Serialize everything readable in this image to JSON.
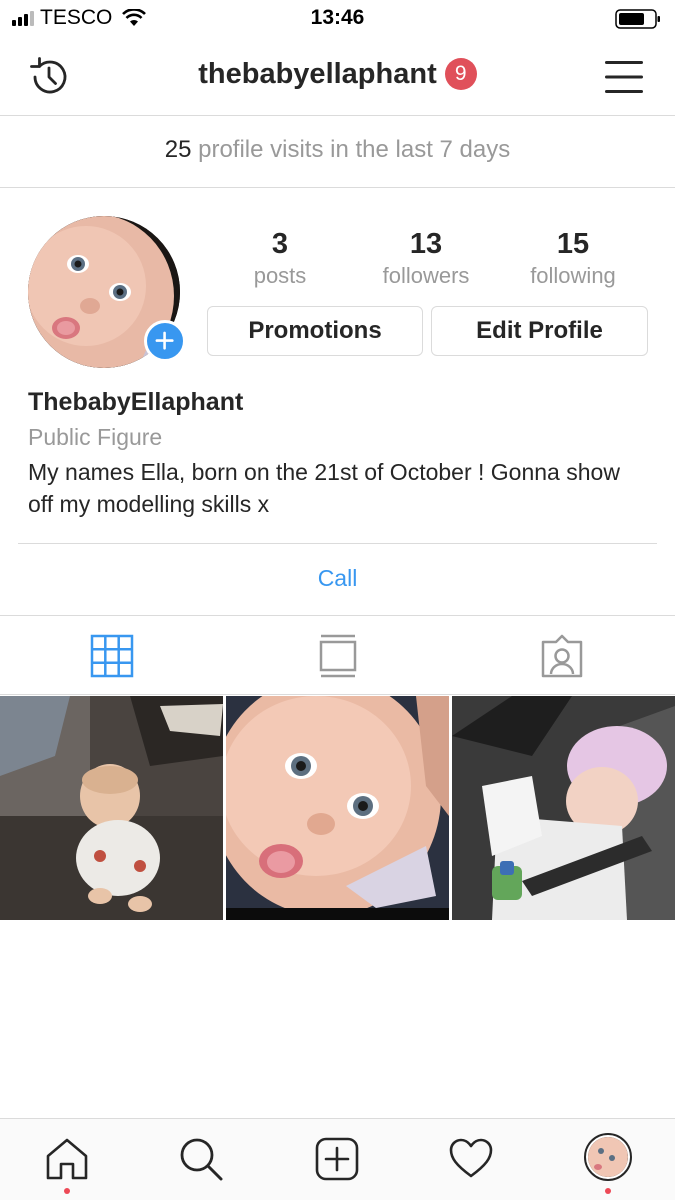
{
  "status_bar": {
    "carrier": "TESCO",
    "time": "13:46",
    "signal_bars": 3
  },
  "header": {
    "username": "thebabyellaphant",
    "notification_count": "9"
  },
  "visits": {
    "count": "25",
    "text": "profile visits in the last 7 days"
  },
  "profile": {
    "name": "ThebabyEllaphant",
    "category": "Public Figure",
    "bio": "My names Ella, born on the 21st of October ! Gonna show off my modelling skills x",
    "stats": [
      {
        "value": "3",
        "label": "posts"
      },
      {
        "value": "13",
        "label": "followers"
      },
      {
        "value": "15",
        "label": "following"
      }
    ],
    "promotions_label": "Promotions",
    "edit_label": "Edit Profile",
    "call_label": "Call"
  },
  "tabs": [
    {
      "icon": "grid-icon",
      "active": true
    },
    {
      "icon": "feed-icon",
      "active": false
    },
    {
      "icon": "tagged-icon",
      "active": false
    }
  ],
  "posts": [
    {
      "description_icon": "photo-thumbnail"
    },
    {
      "description_icon": "photo-thumbnail"
    },
    {
      "description_icon": "photo-thumbnail"
    }
  ],
  "nav": [
    "home-icon",
    "search-icon",
    "add-post-icon",
    "heart-icon",
    "profile-avatar"
  ],
  "colors": {
    "accent": "#3897f0",
    "badge": "#e0505a",
    "border": "#dbdbdb",
    "muted": "#999999",
    "notification_dot": "#ed4956"
  }
}
